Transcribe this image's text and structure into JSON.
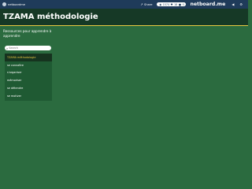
{
  "topbar": {
    "user_name": "netboardme",
    "share_label": "Share",
    "stats": {
      "views": "1574",
      "likes": "18",
      "count": "0"
    },
    "logo": "netboard.me"
  },
  "header": {
    "title": "TZAMA méthodologie"
  },
  "panel": {
    "title": "Ressources pour apprendre à apprendre",
    "search": {
      "placeholder": "Search",
      "value": ""
    },
    "items": [
      {
        "label": "TZAMA méthodologie",
        "active": true
      },
      {
        "label": "se connaître",
        "active": false
      },
      {
        "label": "s'organiser",
        "active": false
      },
      {
        "label": "mémoriser",
        "active": false
      },
      {
        "label": "se détendre",
        "active": false
      },
      {
        "label": "se motiver",
        "active": false
      }
    ]
  },
  "colors": {
    "background": "#2b6b3f",
    "header": "#163926",
    "topbar": "#1f3b5a",
    "accent": "#e8c842"
  }
}
